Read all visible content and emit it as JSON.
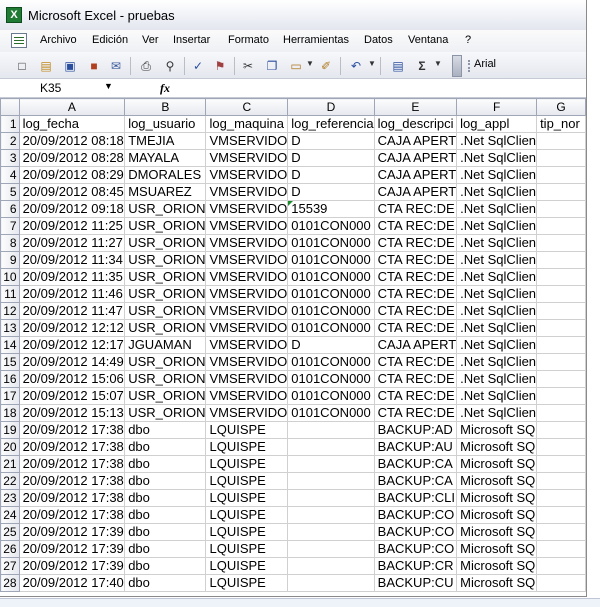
{
  "window": {
    "title": "Microsoft Excel - pruebas",
    "app_icon": "X"
  },
  "menu": [
    "Archivo",
    "Edición",
    "Ver",
    "Insertar",
    "Formato",
    "Herramientas",
    "Datos",
    "Ventana",
    "?"
  ],
  "toolbar": {
    "font_name": "Arial",
    "sum_symbol": "Σ"
  },
  "formula_bar": {
    "cell_ref": "K35",
    "fx_label": "fx"
  },
  "columns": [
    "A",
    "B",
    "C",
    "D",
    "E",
    "F",
    "G"
  ],
  "rows": [
    {
      "n": "1",
      "cells": [
        "log_fecha",
        "log_usuario",
        "log_maquina",
        "log_referencia",
        "log_descripci",
        "log_appl",
        "tip_nor"
      ]
    },
    {
      "n": "2",
      "cells": [
        "20/09/2012 08:18",
        "TMEJIA",
        "VMSERVIDO",
        "D",
        "CAJA APERT",
        ".Net SqlClien",
        ""
      ]
    },
    {
      "n": "3",
      "cells": [
        "20/09/2012 08:28",
        "MAYALA",
        "VMSERVIDO",
        "D",
        "CAJA APERT",
        ".Net SqlClien",
        ""
      ]
    },
    {
      "n": "4",
      "cells": [
        "20/09/2012 08:29",
        "DMORALES",
        "VMSERVIDO",
        "D",
        "CAJA APERT",
        ".Net SqlClien",
        ""
      ]
    },
    {
      "n": "5",
      "cells": [
        "20/09/2012 08:45",
        "MSUAREZ",
        "VMSERVIDO",
        "D",
        "CAJA APERT",
        ".Net SqlClien",
        ""
      ]
    },
    {
      "n": "6",
      "cells": [
        "20/09/2012 09:18",
        "USR_ORION",
        "VMSERVIDO",
        "15539",
        "CTA REC:DE",
        ".Net SqlClien",
        ""
      ]
    },
    {
      "n": "7",
      "cells": [
        "20/09/2012 11:25",
        "USR_ORION",
        "VMSERVIDO",
        "0101CON000",
        "CTA REC:DE",
        ".Net SqlClien",
        ""
      ]
    },
    {
      "n": "8",
      "cells": [
        "20/09/2012 11:27",
        "USR_ORION",
        "VMSERVIDO",
        "0101CON000",
        "CTA REC:DE",
        ".Net SqlClien",
        ""
      ]
    },
    {
      "n": "9",
      "cells": [
        "20/09/2012 11:34",
        "USR_ORION",
        "VMSERVIDO",
        "0101CON000",
        "CTA REC:DE",
        ".Net SqlClien",
        ""
      ]
    },
    {
      "n": "10",
      "cells": [
        "20/09/2012 11:35",
        "USR_ORION",
        "VMSERVIDO",
        "0101CON000",
        "CTA REC:DE",
        ".Net SqlClien",
        ""
      ]
    },
    {
      "n": "11",
      "cells": [
        "20/09/2012 11:46",
        "USR_ORION",
        "VMSERVIDO",
        "0101CON000",
        "CTA REC:DE",
        ".Net SqlClien",
        ""
      ]
    },
    {
      "n": "12",
      "cells": [
        "20/09/2012 11:47",
        "USR_ORION",
        "VMSERVIDO",
        "0101CON000",
        "CTA REC:DE",
        ".Net SqlClien",
        ""
      ]
    },
    {
      "n": "13",
      "cells": [
        "20/09/2012 12:12",
        "USR_ORION",
        "VMSERVIDO",
        "0101CON000",
        "CTA REC:DE",
        ".Net SqlClien",
        ""
      ]
    },
    {
      "n": "14",
      "cells": [
        "20/09/2012 12:17",
        "JGUAMAN",
        "VMSERVIDO",
        "D",
        "CAJA APERT",
        ".Net SqlClien",
        ""
      ]
    },
    {
      "n": "15",
      "cells": [
        "20/09/2012 14:49",
        "USR_ORION",
        "VMSERVIDO",
        "0101CON000",
        "CTA REC:DE",
        ".Net SqlClien",
        ""
      ]
    },
    {
      "n": "16",
      "cells": [
        "20/09/2012 15:06",
        "USR_ORION",
        "VMSERVIDO",
        "0101CON000",
        "CTA REC:DE",
        ".Net SqlClien",
        ""
      ]
    },
    {
      "n": "17",
      "cells": [
        "20/09/2012 15:07",
        "USR_ORION",
        "VMSERVIDO",
        "0101CON000",
        "CTA REC:DE",
        ".Net SqlClien",
        ""
      ]
    },
    {
      "n": "18",
      "cells": [
        "20/09/2012 15:13",
        "USR_ORION",
        "VMSERVIDO",
        "0101CON000",
        "CTA REC:DE",
        ".Net SqlClien",
        ""
      ]
    },
    {
      "n": "19",
      "cells": [
        "20/09/2012 17:38",
        "dbo",
        "LQUISPE",
        "",
        "BACKUP:AD",
        "Microsoft SQ",
        ""
      ]
    },
    {
      "n": "20",
      "cells": [
        "20/09/2012 17:38",
        "dbo",
        "LQUISPE",
        "",
        "BACKUP:AU",
        "Microsoft SQ",
        ""
      ]
    },
    {
      "n": "21",
      "cells": [
        "20/09/2012 17:38",
        "dbo",
        "LQUISPE",
        "",
        "BACKUP:CA",
        "Microsoft SQ",
        ""
      ]
    },
    {
      "n": "22",
      "cells": [
        "20/09/2012 17:38",
        "dbo",
        "LQUISPE",
        "",
        "BACKUP:CA",
        "Microsoft SQ",
        ""
      ]
    },
    {
      "n": "23",
      "cells": [
        "20/09/2012 17:38",
        "dbo",
        "LQUISPE",
        "",
        "BACKUP:CLI",
        "Microsoft SQ",
        ""
      ]
    },
    {
      "n": "24",
      "cells": [
        "20/09/2012 17:38",
        "dbo",
        "LQUISPE",
        "",
        "BACKUP:CO",
        "Microsoft SQ",
        ""
      ]
    },
    {
      "n": "25",
      "cells": [
        "20/09/2012 17:39",
        "dbo",
        "LQUISPE",
        "",
        "BACKUP:CO",
        "Microsoft SQ",
        ""
      ]
    },
    {
      "n": "26",
      "cells": [
        "20/09/2012 17:39",
        "dbo",
        "LQUISPE",
        "",
        "BACKUP:CO",
        "Microsoft SQ",
        ""
      ]
    },
    {
      "n": "27",
      "cells": [
        "20/09/2012 17:39",
        "dbo",
        "LQUISPE",
        "",
        "BACKUP:CR",
        "Microsoft SQ",
        ""
      ]
    },
    {
      "n": "28",
      "cells": [
        "20/09/2012 17:40",
        "dbo",
        "LQUISPE",
        "",
        "BACKUP:CU",
        "Microsoft SQ",
        ""
      ]
    }
  ],
  "comment_cell": {
    "row": "6",
    "col": "D"
  }
}
